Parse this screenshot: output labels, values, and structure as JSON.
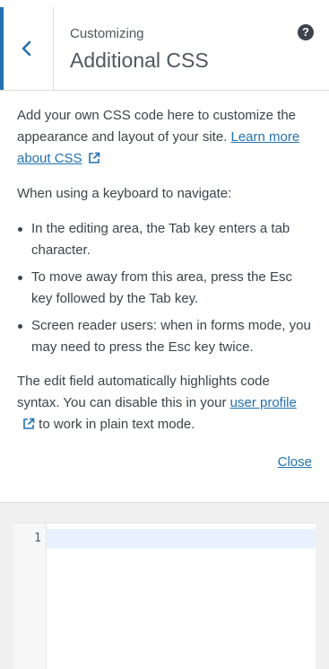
{
  "header": {
    "back_label": "Back",
    "subtitle": "Customizing",
    "title": "Additional CSS",
    "help_glyph": "?"
  },
  "description": {
    "intro_text": "Add your own CSS code here to customize the appearance and layout of your site.",
    "learn_more_link": "Learn more about CSS",
    "keyboard_heading": "When using a keyboard to navigate:",
    "bullets": [
      "In the editing area, the Tab key enters a tab character.",
      "To move away from this area, press the Esc key followed by the Tab key.",
      "Screen reader users: when in forms mode, you may need to press the Esc key twice."
    ],
    "syntax_text_before": "The edit field automatically highlights code syntax. You can disable this in your",
    "user_profile_link": "user profile",
    "syntax_text_after": "to work in plain text mode.",
    "close_link": "Close"
  },
  "editor": {
    "line_numbers": [
      "1"
    ],
    "content": ""
  },
  "colors": {
    "accent": "#2271b1",
    "text": "#3c434a",
    "active_line": "#e8f2ff"
  },
  "icons": {
    "back": "chevron-left-icon",
    "help": "help-icon",
    "external": "external-link-icon"
  }
}
